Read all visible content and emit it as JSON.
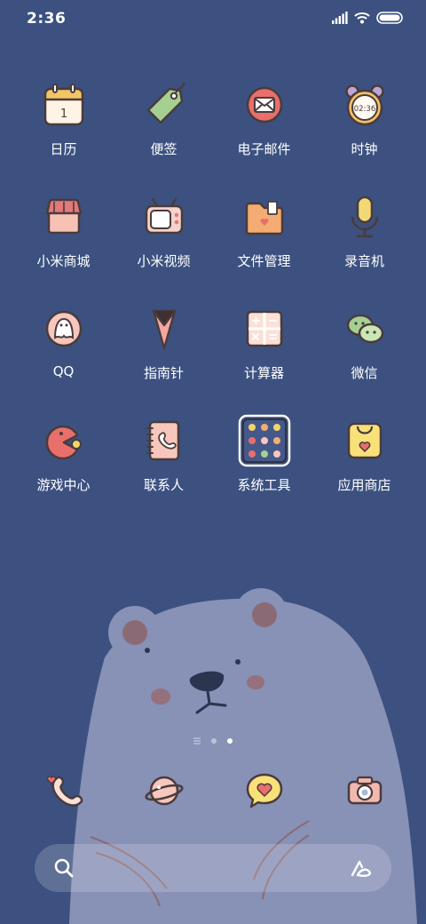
{
  "status": {
    "time": "2:36"
  },
  "apps": [
    {
      "label": "日历",
      "icon": "calendar-icon"
    },
    {
      "label": "便签",
      "icon": "tag-icon"
    },
    {
      "label": "电子邮件",
      "icon": "envelope-icon"
    },
    {
      "label": "时钟",
      "icon": "alarm-clock-icon",
      "clock_text": "02:36"
    },
    {
      "label": "小米商城",
      "icon": "shop-icon"
    },
    {
      "label": "小米视频",
      "icon": "tv-icon"
    },
    {
      "label": "文件管理",
      "icon": "folder-icon"
    },
    {
      "label": "录音机",
      "icon": "microphone-icon"
    },
    {
      "label": "QQ",
      "icon": "penguin-icon"
    },
    {
      "label": "指南针",
      "icon": "compass-icon"
    },
    {
      "label": "计算器",
      "icon": "calculator-icon"
    },
    {
      "label": "微信",
      "icon": "chat-bubbles-icon"
    },
    {
      "label": "游戏中心",
      "icon": "game-icon"
    },
    {
      "label": "联系人",
      "icon": "contacts-book-icon"
    },
    {
      "label": "系统工具",
      "icon": "folder-grid-icon"
    },
    {
      "label": "应用商店",
      "icon": "shopping-bag-icon"
    }
  ],
  "calendar_day": "1",
  "page_indicator": {
    "pages": 3,
    "current": 3
  },
  "dock": [
    {
      "icon": "phone-icon"
    },
    {
      "icon": "planet-icon"
    },
    {
      "icon": "heart-message-icon"
    },
    {
      "icon": "camera-icon"
    }
  ],
  "search": {
    "icon": "search-icon",
    "assistant_icon": "assistant-icon"
  },
  "colors": {
    "background": "#3c5180",
    "bear": "#8a93b8",
    "icon_outline": "#4a3b3b",
    "pink": "#f2b8b0"
  }
}
